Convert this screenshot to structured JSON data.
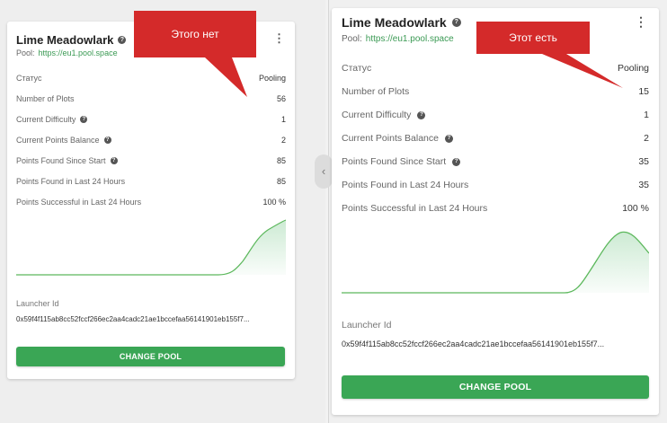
{
  "left_card": {
    "title": "Lime Meadowlark",
    "pool_label": "Pool:",
    "pool_url": "https://eu1.pool.space",
    "rows": [
      {
        "label": "Статус",
        "value": "Pooling"
      },
      {
        "label": "Number of Plots",
        "value": "56"
      },
      {
        "label": "Current Difficulty",
        "value": "1"
      },
      {
        "label": "Current Points Balance",
        "value": "2"
      },
      {
        "label": "Points Found Since Start",
        "value": "85"
      },
      {
        "label": "Points Found in Last 24 Hours",
        "value": "85"
      },
      {
        "label": "Points Successful in Last 24 Hours",
        "value": "100 %"
      }
    ],
    "launcher_label": "Launcher Id",
    "launcher_id": "0x59f4f115ab8cc52fccf266ec2aa4cadc21ae1bccefaa56141901eb155f7...",
    "button_label": "CHANGE POOL"
  },
  "right_card": {
    "title": "Lime Meadowlark",
    "pool_label": "Pool:",
    "pool_url": "https://eu1.pool.space",
    "rows": [
      {
        "label": "Статус",
        "value": "Pooling"
      },
      {
        "label": "Number of Plots",
        "value": "15"
      },
      {
        "label": "Current Difficulty",
        "value": "1"
      },
      {
        "label": "Current Points Balance",
        "value": "2"
      },
      {
        "label": "Points Found Since Start",
        "value": "35"
      },
      {
        "label": "Points Found in Last 24 Hours",
        "value": "35"
      },
      {
        "label": "Points Successful in Last 24 Hours",
        "value": "100 %"
      }
    ],
    "launcher_label": "Launcher Id",
    "launcher_id": "0x59f4f115ab8cc52fccf266ec2aa4cadc21ae1bccefaa56141901eb155f7...",
    "button_label": "CHANGE POOL"
  },
  "annotations": {
    "left_note": "Этого нет",
    "right_note": "Этот есть"
  },
  "icons": {
    "help": "question-circle-icon",
    "menu": "more-vertical-icon",
    "divider": "chevron-left-icon"
  },
  "colors": {
    "accent_green": "#3aa655",
    "annotation_red": "#d42a2a"
  }
}
